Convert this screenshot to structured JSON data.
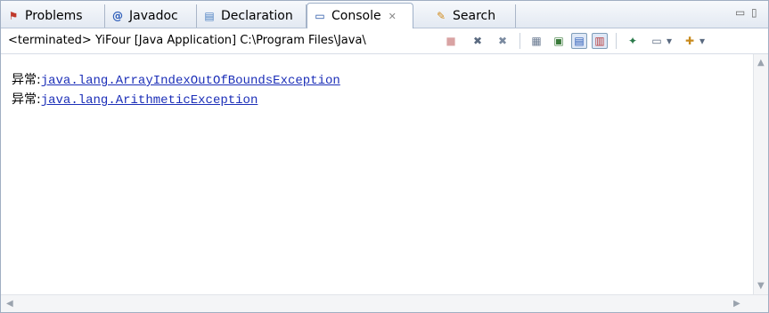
{
  "tabs": [
    {
      "label": "Problems",
      "icon": "problems-icon",
      "glyph": "⚑"
    },
    {
      "label": "Javadoc",
      "icon": "javadoc-icon",
      "glyph": "@"
    },
    {
      "label": "Declaration",
      "icon": "declaration-icon",
      "glyph": "▤"
    },
    {
      "label": "Console",
      "icon": "console-icon",
      "glyph": "▭",
      "active": true,
      "close_glyph": "✕"
    },
    {
      "label": "Search",
      "icon": "search-icon",
      "glyph": "✎"
    }
  ],
  "window_controls": {
    "minimize": "▭",
    "maximize": "▯"
  },
  "toolbar": {
    "process_label": "<terminated> YiFour [Java Application] C:\\Program Files\\Java\\",
    "buttons": [
      {
        "name": "terminate-icon",
        "glyph": "■"
      },
      {
        "name": "remove-launch-icon",
        "glyph": "✖"
      },
      {
        "name": "remove-all-terminated-icon",
        "glyph": "✖"
      },
      {
        "name": "clear-console-icon",
        "glyph": "▦"
      },
      {
        "name": "scroll-lock-icon",
        "glyph": "▣"
      },
      {
        "name": "show-on-stdout-icon",
        "glyph": "▤"
      },
      {
        "name": "show-on-stderr-icon",
        "glyph": "▥"
      },
      {
        "name": "pin-console-icon",
        "glyph": "✦"
      },
      {
        "name": "display-console-icon",
        "glyph": "▭"
      },
      {
        "name": "display-dropdown-icon",
        "glyph": "▾"
      },
      {
        "name": "open-console-icon",
        "glyph": "✚"
      },
      {
        "name": "open-console-dropdown-icon",
        "glyph": "▾"
      }
    ]
  },
  "console_lines": [
    {
      "label": "异常:",
      "exception": "java.lang.ArrayIndexOutOfBoundsException"
    },
    {
      "label": "异常:",
      "exception": "java.lang.ArithmeticException"
    }
  ],
  "scroll": {
    "up": "▲",
    "down": "▼",
    "left": "◀",
    "right": "▶"
  },
  "colors": {
    "link": "#1c2fb8",
    "tab_border": "#9fb0c8",
    "terminate_disabled": "#d9a3a3",
    "remove_red": "#5a6a80"
  }
}
